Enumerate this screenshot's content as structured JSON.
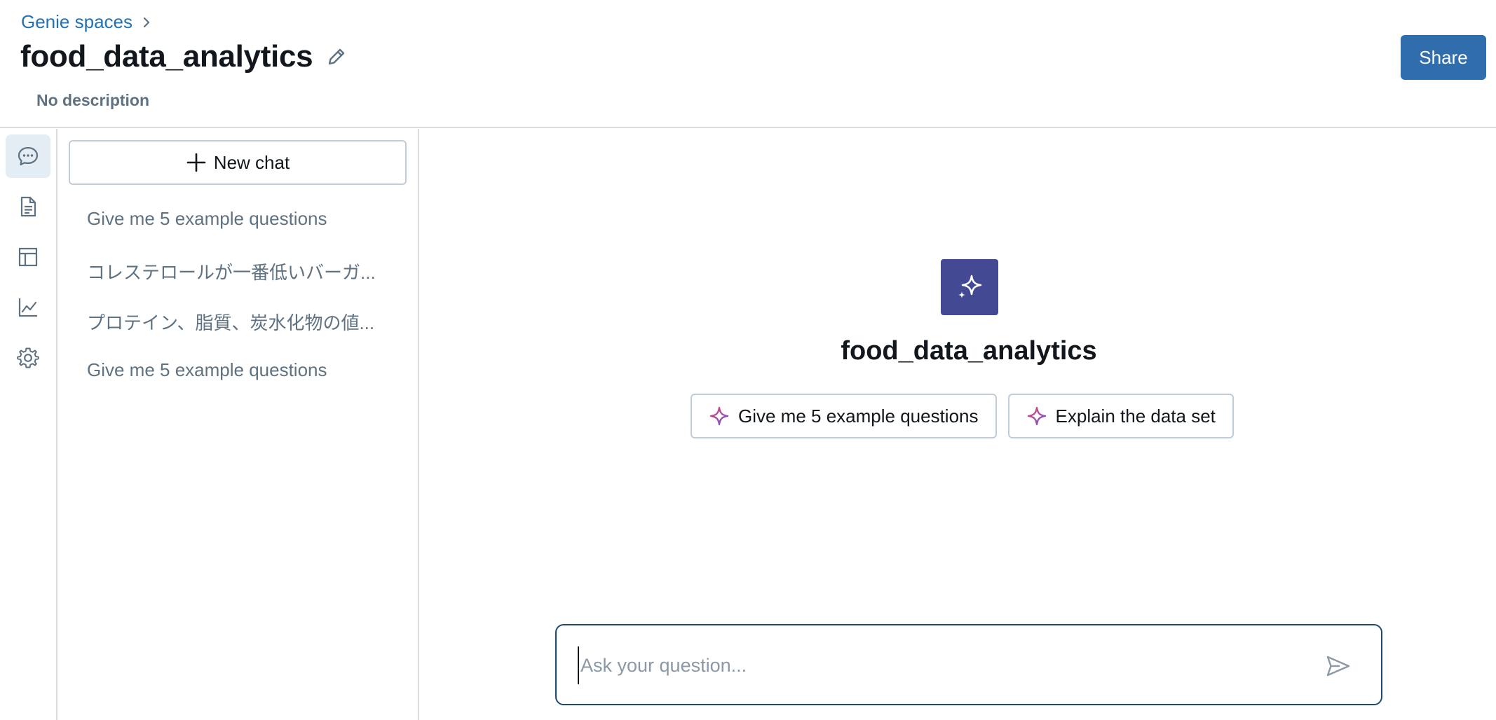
{
  "header": {
    "breadcrumb_label": "Genie spaces",
    "title": "food_data_analytics",
    "description": "No description",
    "share_label": "Share"
  },
  "rail": {
    "items": [
      {
        "icon": "chat-bubble-icon",
        "active": true
      },
      {
        "icon": "document-icon",
        "active": false
      },
      {
        "icon": "table-icon",
        "active": false
      },
      {
        "icon": "line-chart-icon",
        "active": false
      },
      {
        "icon": "gear-icon",
        "active": false
      }
    ]
  },
  "chat_panel": {
    "new_chat_label": "New chat",
    "history": [
      "Give me 5 example questions",
      "コレステロールが一番低いバーガ...",
      "プロテイン、脂質、炭水化物の値...",
      "Give me 5 example questions"
    ]
  },
  "main": {
    "space_name": "food_data_analytics",
    "suggestions": [
      "Give me 5 example questions",
      "Explain the data set"
    ],
    "ask_placeholder": "Ask your question..."
  },
  "colors": {
    "accent": "#2f6dac",
    "link": "#2272b4",
    "logo_bg": "#434a93",
    "muted_text": "#5f7281",
    "border": "#c0cdd8"
  }
}
